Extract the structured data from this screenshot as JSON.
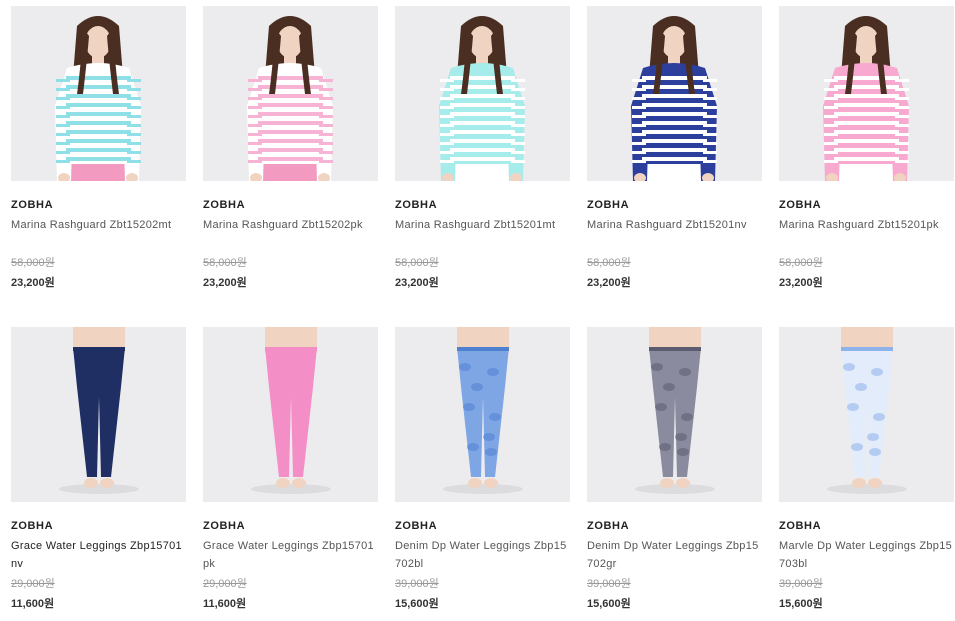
{
  "products": [
    {
      "brand": "ZOBHA",
      "name": "Marina Rashguard Zbt15202mt",
      "old_price": "58,000원",
      "price": "23,200원",
      "kind": "top",
      "colors": {
        "body": "#ffffff",
        "stripe": "#8fe0e6",
        "sleeve": "#ffffff",
        "bottom": "#f39ac0"
      }
    },
    {
      "brand": "ZOBHA",
      "name": "Marina Rashguard Zbt15202pk",
      "old_price": "58,000원",
      "price": "23,200원",
      "kind": "top",
      "colors": {
        "body": "#ffffff",
        "stripe": "#f7b3d3",
        "sleeve": "#ffffff",
        "bottom": "#f39ac0"
      }
    },
    {
      "brand": "ZOBHA",
      "name": "Marina Rashguard Zbt15201mt",
      "old_price": "58,000원",
      "price": "23,200원",
      "kind": "top",
      "colors": {
        "body": "#a6ecea",
        "stripe": "#ffffff",
        "sleeve": "#a6ecea",
        "bottom": "#ffffff"
      }
    },
    {
      "brand": "ZOBHA",
      "name": "Marina Rashguard Zbt15201nv",
      "old_price": "58,000원",
      "price": "23,200원",
      "kind": "top",
      "colors": {
        "body": "#2d3f9c",
        "stripe": "#ffffff",
        "sleeve": "#2d3f9c",
        "bottom": "#ffffff"
      }
    },
    {
      "brand": "ZOBHA",
      "name": "Marina Rashguard Zbt15201pk",
      "old_price": "58,000원",
      "price": "23,200원",
      "kind": "top",
      "colors": {
        "body": "#f7a9cf",
        "stripe": "#ffffff",
        "sleeve": "#f7a9cf",
        "bottom": "#ffffff"
      }
    },
    {
      "brand": "ZOBHA",
      "name": "Grace Water Leggings Zbp15701nv",
      "old_price": "29,000원",
      "price": "11,600원",
      "kind": "leggings",
      "colors": {
        "leg": "#1f2f63",
        "accent": "#1f2f63"
      }
    },
    {
      "brand": "ZOBHA",
      "name": "Grace Water Leggings Zbp15701pk",
      "old_price": "29,000원",
      "price": "11,600원",
      "kind": "leggings",
      "colors": {
        "leg": "#f48ec6",
        "accent": "#f48ec6"
      }
    },
    {
      "brand": "ZOBHA",
      "name": "Denim Dp Water Leggings Zbp15702bl",
      "old_price": "39,000원",
      "price": "15,600원",
      "kind": "leggings",
      "colors": {
        "leg": "#7fa6e4",
        "accent": "#4f7fcf"
      }
    },
    {
      "brand": "ZOBHA",
      "name": "Denim Dp Water Leggings Zbp15702gr",
      "old_price": "39,000원",
      "price": "15,600원",
      "kind": "leggings",
      "colors": {
        "leg": "#8a8b9e",
        "accent": "#5b5c70"
      }
    },
    {
      "brand": "ZOBHA",
      "name": "Marvle Dp Water Leggings Zbp15703bl",
      "old_price": "39,000원",
      "price": "15,600원",
      "kind": "leggings",
      "colors": {
        "leg": "#e3ecfb",
        "accent": "#8eb3ea"
      }
    }
  ]
}
